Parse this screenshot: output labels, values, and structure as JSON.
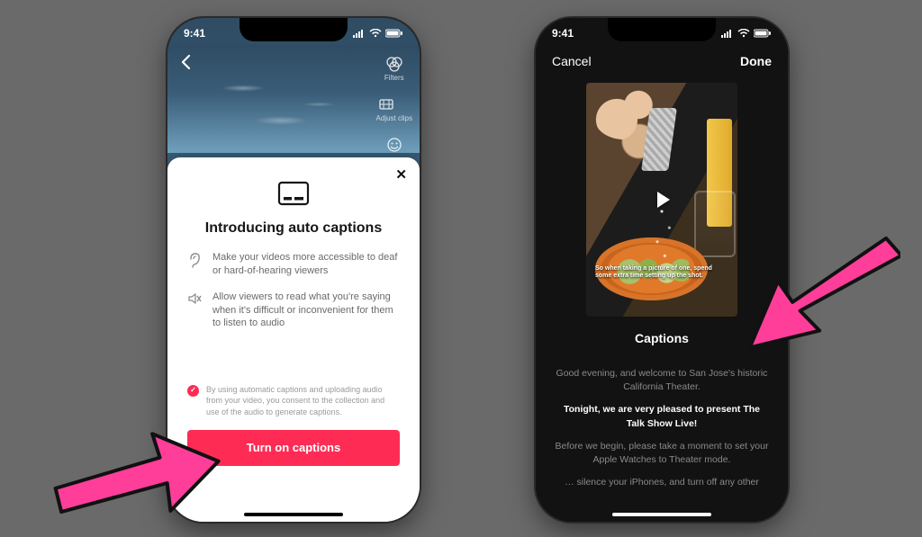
{
  "status": {
    "time": "9:41"
  },
  "left_phone": {
    "side_labels": {
      "filters": "Filters",
      "adjust": "Adjust clips"
    },
    "sheet": {
      "title": "Introducing auto captions",
      "bullet1": "Make your videos more accessible to deaf or hard-of-hearing viewers",
      "bullet2": "Allow viewers to read what you're saying when it's difficult or inconvenient for them to listen to audio",
      "consent": "By using automatic captions and uploading audio from your video, you consent to the collection and use of the audio to generate captions.",
      "cta": "Turn on captions"
    }
  },
  "right_phone": {
    "cancel": "Cancel",
    "done": "Done",
    "preview_caption": "So when taking a picture of one, spend some extra time setting up the shot.",
    "captions_header": "Captions",
    "lines": {
      "l1": "Good evening, and welcome to San Jose's historic California Theater.",
      "l2": "Tonight, we are very pleased to present The Talk Show Live!",
      "l3": "Before we begin, please take a moment to set your Apple Watches to Theater mode.",
      "l4": "… silence your iPhones, and turn off any other"
    }
  }
}
